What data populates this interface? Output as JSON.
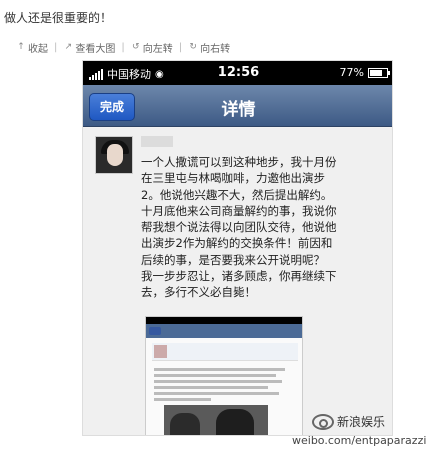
{
  "caption": "做人还是很重要的！",
  "toolbar": {
    "items": [
      {
        "icon": "collapse-icon",
        "label": "收起"
      },
      {
        "icon": "view-large-icon",
        "label": "查看大图"
      },
      {
        "icon": "rotate-left-icon",
        "label": "向左转"
      },
      {
        "icon": "rotate-right-icon",
        "label": "向右转"
      }
    ]
  },
  "phone": {
    "status_bar": {
      "carrier": "中国移动",
      "time": "12:56",
      "battery": "77%",
      "battery_level": 0.77
    },
    "nav": {
      "done_label": "完成",
      "title": "详情"
    },
    "post": {
      "lines": [
        "一个人撒谎可以到这种地步，我十月份",
        "在三里屯与林喝咖啡，力邀他出演步",
        "2。他说他兴趣不大，然后提出解约。",
        "十月底他来公司商量解约的事，我说你",
        "帮我想个说法得以向团队交待，他说他",
        "出演步2作为解约的交换条件！前因和",
        "后续的事，是否要我来公开说明呢？",
        "我一步步忍让，诸多顾虑，你再继续下",
        "去，多行不义必自毙！"
      ]
    }
  },
  "watermark": {
    "brand": "新浪娱乐",
    "url": "weibo.com/entpaparazzi"
  },
  "colors": {
    "nav_bar": "#4b6a96",
    "done_button": "#2a63c8",
    "status_bar": "#000000"
  }
}
